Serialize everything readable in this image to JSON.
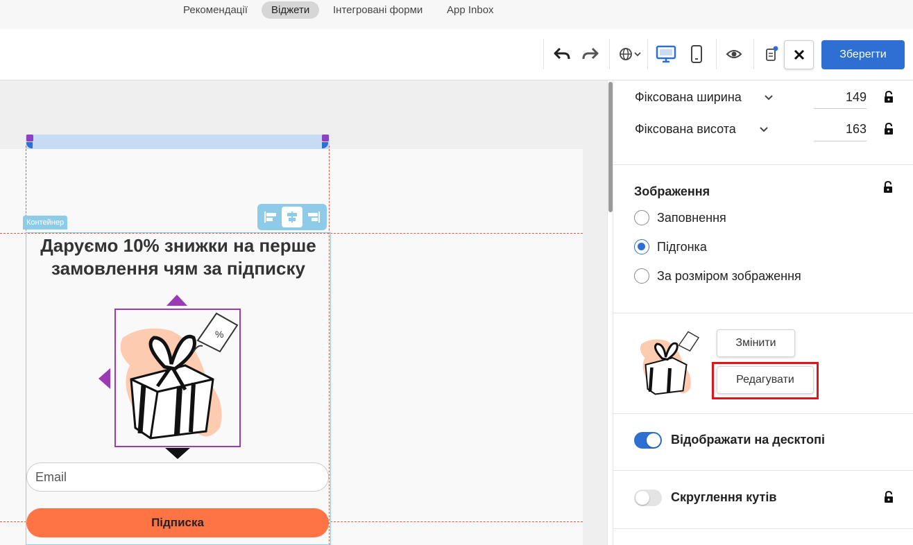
{
  "nav": {
    "tabs": [
      {
        "label": "Рекомендації",
        "active": false
      },
      {
        "label": "Віджети",
        "active": true
      },
      {
        "label": "Інтегровані форми",
        "active": false
      },
      {
        "label": "App Inbox",
        "active": false
      }
    ]
  },
  "toolbar": {
    "icons": [
      "undo-icon",
      "redo-icon",
      "globe-language-icon",
      "desktop-preview-icon",
      "mobile-preview-icon",
      "eye-preview-icon",
      "clipboard-notification-icon",
      "close-icon"
    ],
    "save_label": "Зберегти"
  },
  "canvas": {
    "container_label": "Контейнер",
    "widget_title": "Даруємо 10% знижки на перше замовлення чям за підписку",
    "image_name": "gift-box-illustration",
    "email_placeholder": "Email",
    "subscribe_label": "Підписка"
  },
  "panel": {
    "fixed_width_label": "Фіксована ширина",
    "fixed_width_value": "149",
    "fixed_height_label": "Фіксована висота",
    "fixed_height_value": "163",
    "image_section_title": "Зображення",
    "image_options": [
      {
        "label": "Заповнення",
        "checked": false
      },
      {
        "label": "Підгонка",
        "checked": true
      },
      {
        "label": "За розміром зображення",
        "checked": false
      }
    ],
    "change_label": "Змінити",
    "edit_label": "Редагувати",
    "show_desktop_label": "Відображати на десктопі",
    "show_desktop_on": true,
    "rounded_corners_label": "Скруглення кутів",
    "rounded_corners_on": false
  },
  "colors": {
    "accent": "#2e6fd3",
    "subscribe_button": "#ff7444",
    "highlight": "#e0141a",
    "selection": "#9a3ab5"
  }
}
